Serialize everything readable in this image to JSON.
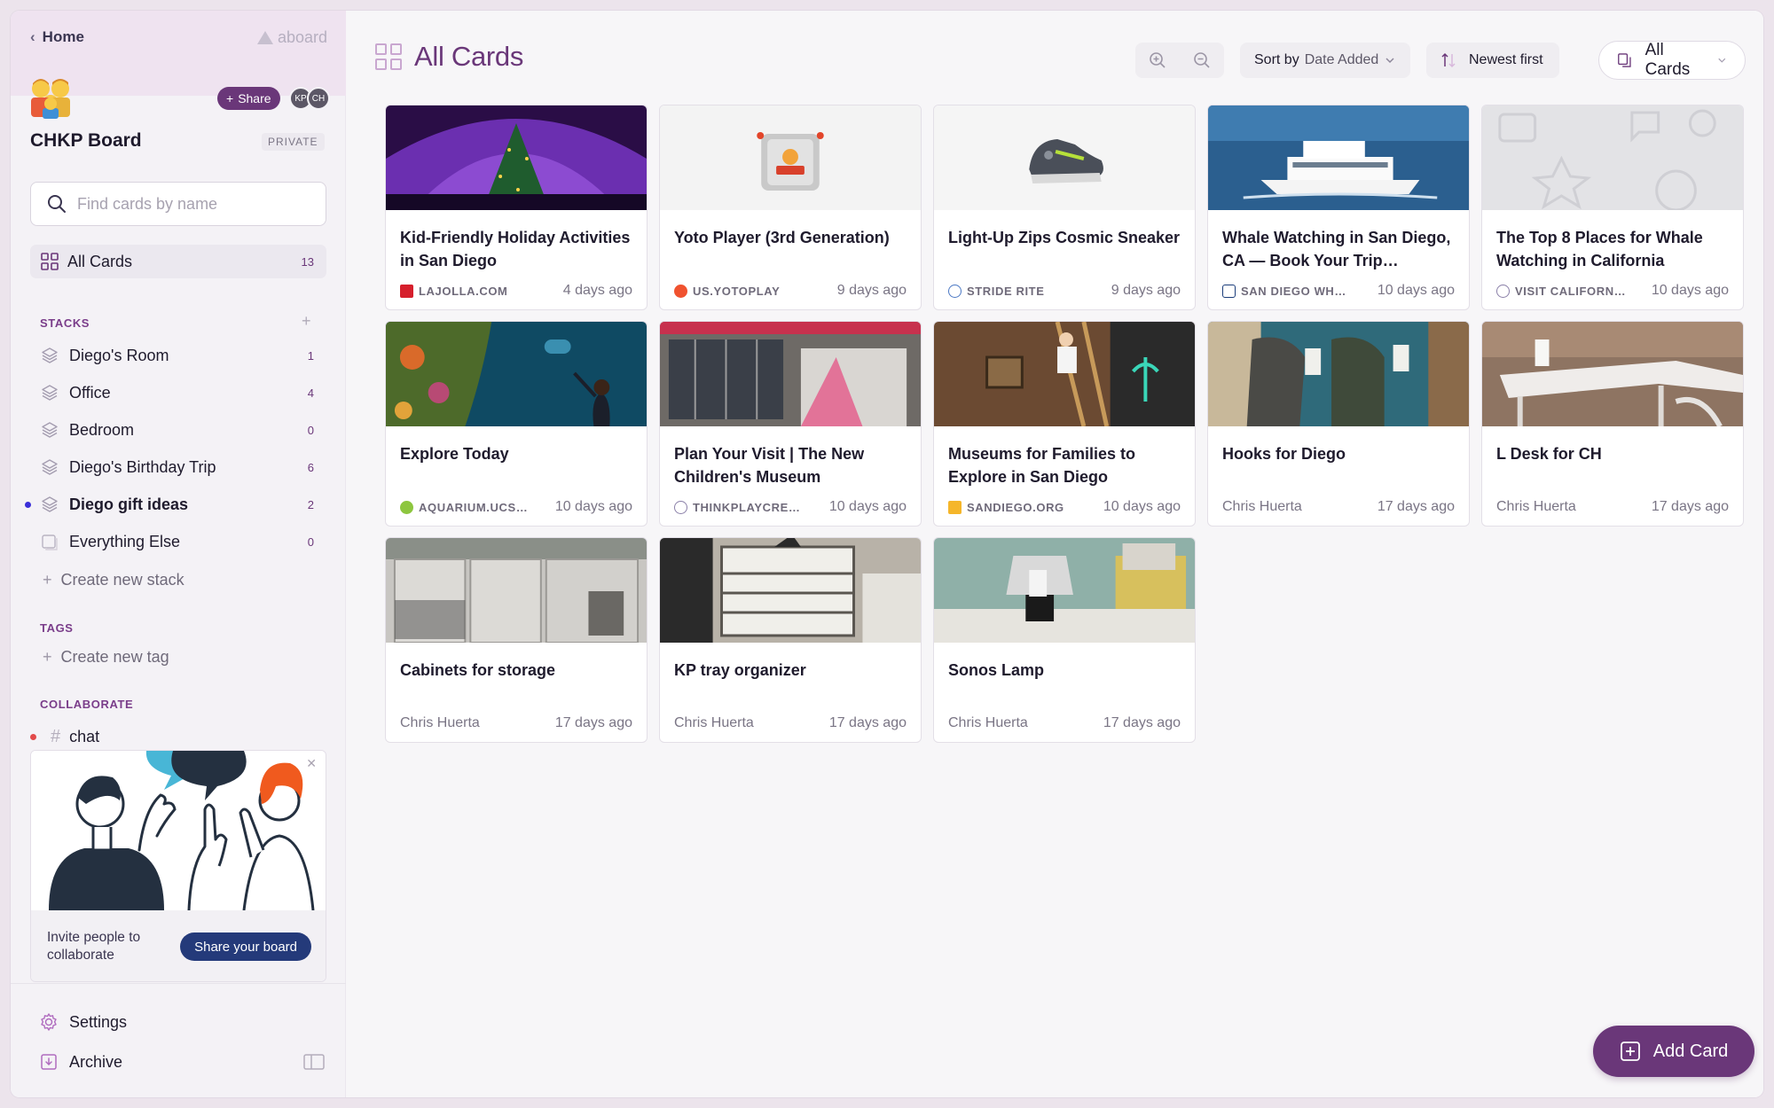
{
  "sidebar": {
    "home_label": "Home",
    "brand": "aboard",
    "share_label": "Share",
    "avatars": [
      "KP",
      "CH"
    ],
    "board_title": "CHKP Board",
    "private_label": "PRIVATE",
    "search_placeholder": "Find cards by name",
    "all_cards": {
      "label": "All Cards",
      "count": "13"
    },
    "stacks_title": "STACKS",
    "stacks": [
      {
        "label": "Diego's Room",
        "count": "1"
      },
      {
        "label": "Office",
        "count": "4"
      },
      {
        "label": "Bedroom",
        "count": "0"
      },
      {
        "label": "Diego's Birthday Trip",
        "count": "6"
      },
      {
        "label": "Diego gift ideas",
        "count": "2"
      },
      {
        "label": "Everything Else",
        "count": "0"
      }
    ],
    "create_stack": "Create new stack",
    "tags_title": "TAGS",
    "create_tag": "Create new tag",
    "collaborate_title": "COLLABORATE",
    "chat_label": "chat",
    "invite_text": "Invite people to collaborate",
    "share_board_label": "Share your board",
    "settings_label": "Settings",
    "archive_label": "Archive"
  },
  "toolbar": {
    "title": "All Cards",
    "sort_key": "Sort by",
    "sort_value": "Date Added",
    "order_label": "Newest first",
    "view_label": "All Cards"
  },
  "cards": [
    {
      "title": "Kid-Friendly Holiday Activities in San Diego",
      "source": "LAJOLLA.COM",
      "time": "4 days ago"
    },
    {
      "title": "Yoto Player (3rd Generation)",
      "source": "US.YOTOPLAY",
      "time": "9 days ago"
    },
    {
      "title": "Light-Up Zips Cosmic Sneaker",
      "source": "STRIDE RITE",
      "time": "9 days ago"
    },
    {
      "title": "Whale Watching in San Diego, CA — Book Your Trip…",
      "source": "SAN DIEGO WH…",
      "time": "10 days ago"
    },
    {
      "title": "The Top 8 Places for Whale Watching in California",
      "source": "VISIT CALIFORN…",
      "time": "10 days ago"
    },
    {
      "title": "Explore Today",
      "source": "AQUARIUM.UCS…",
      "time": "10 days ago"
    },
    {
      "title": "Plan Your Visit | The New Children's Museum",
      "source": "THINKPLAYCRE…",
      "time": "10 days ago"
    },
    {
      "title": "Museums for Families to Explore in San Diego",
      "source": "SANDIEGO.ORG",
      "time": "10 days ago"
    },
    {
      "title": "Hooks for Diego",
      "source": "Chris Huerta",
      "time": "17 days ago"
    },
    {
      "title": "L Desk for CH",
      "source": "Chris Huerta",
      "time": "17 days ago"
    },
    {
      "title": "Cabinets for storage",
      "source": "Chris Huerta",
      "time": "17 days ago"
    },
    {
      "title": "KP tray organizer",
      "source": "Chris Huerta",
      "time": "17 days ago"
    },
    {
      "title": "Sonos Lamp",
      "source": "Chris Huerta",
      "time": "17 days ago"
    }
  ],
  "add_card_label": "Add Card",
  "colors": {
    "accent": "#6a3779",
    "navy": "#243a7a",
    "unread_dot": "#3b2fd9",
    "chat_dot": "#e24a4a"
  }
}
